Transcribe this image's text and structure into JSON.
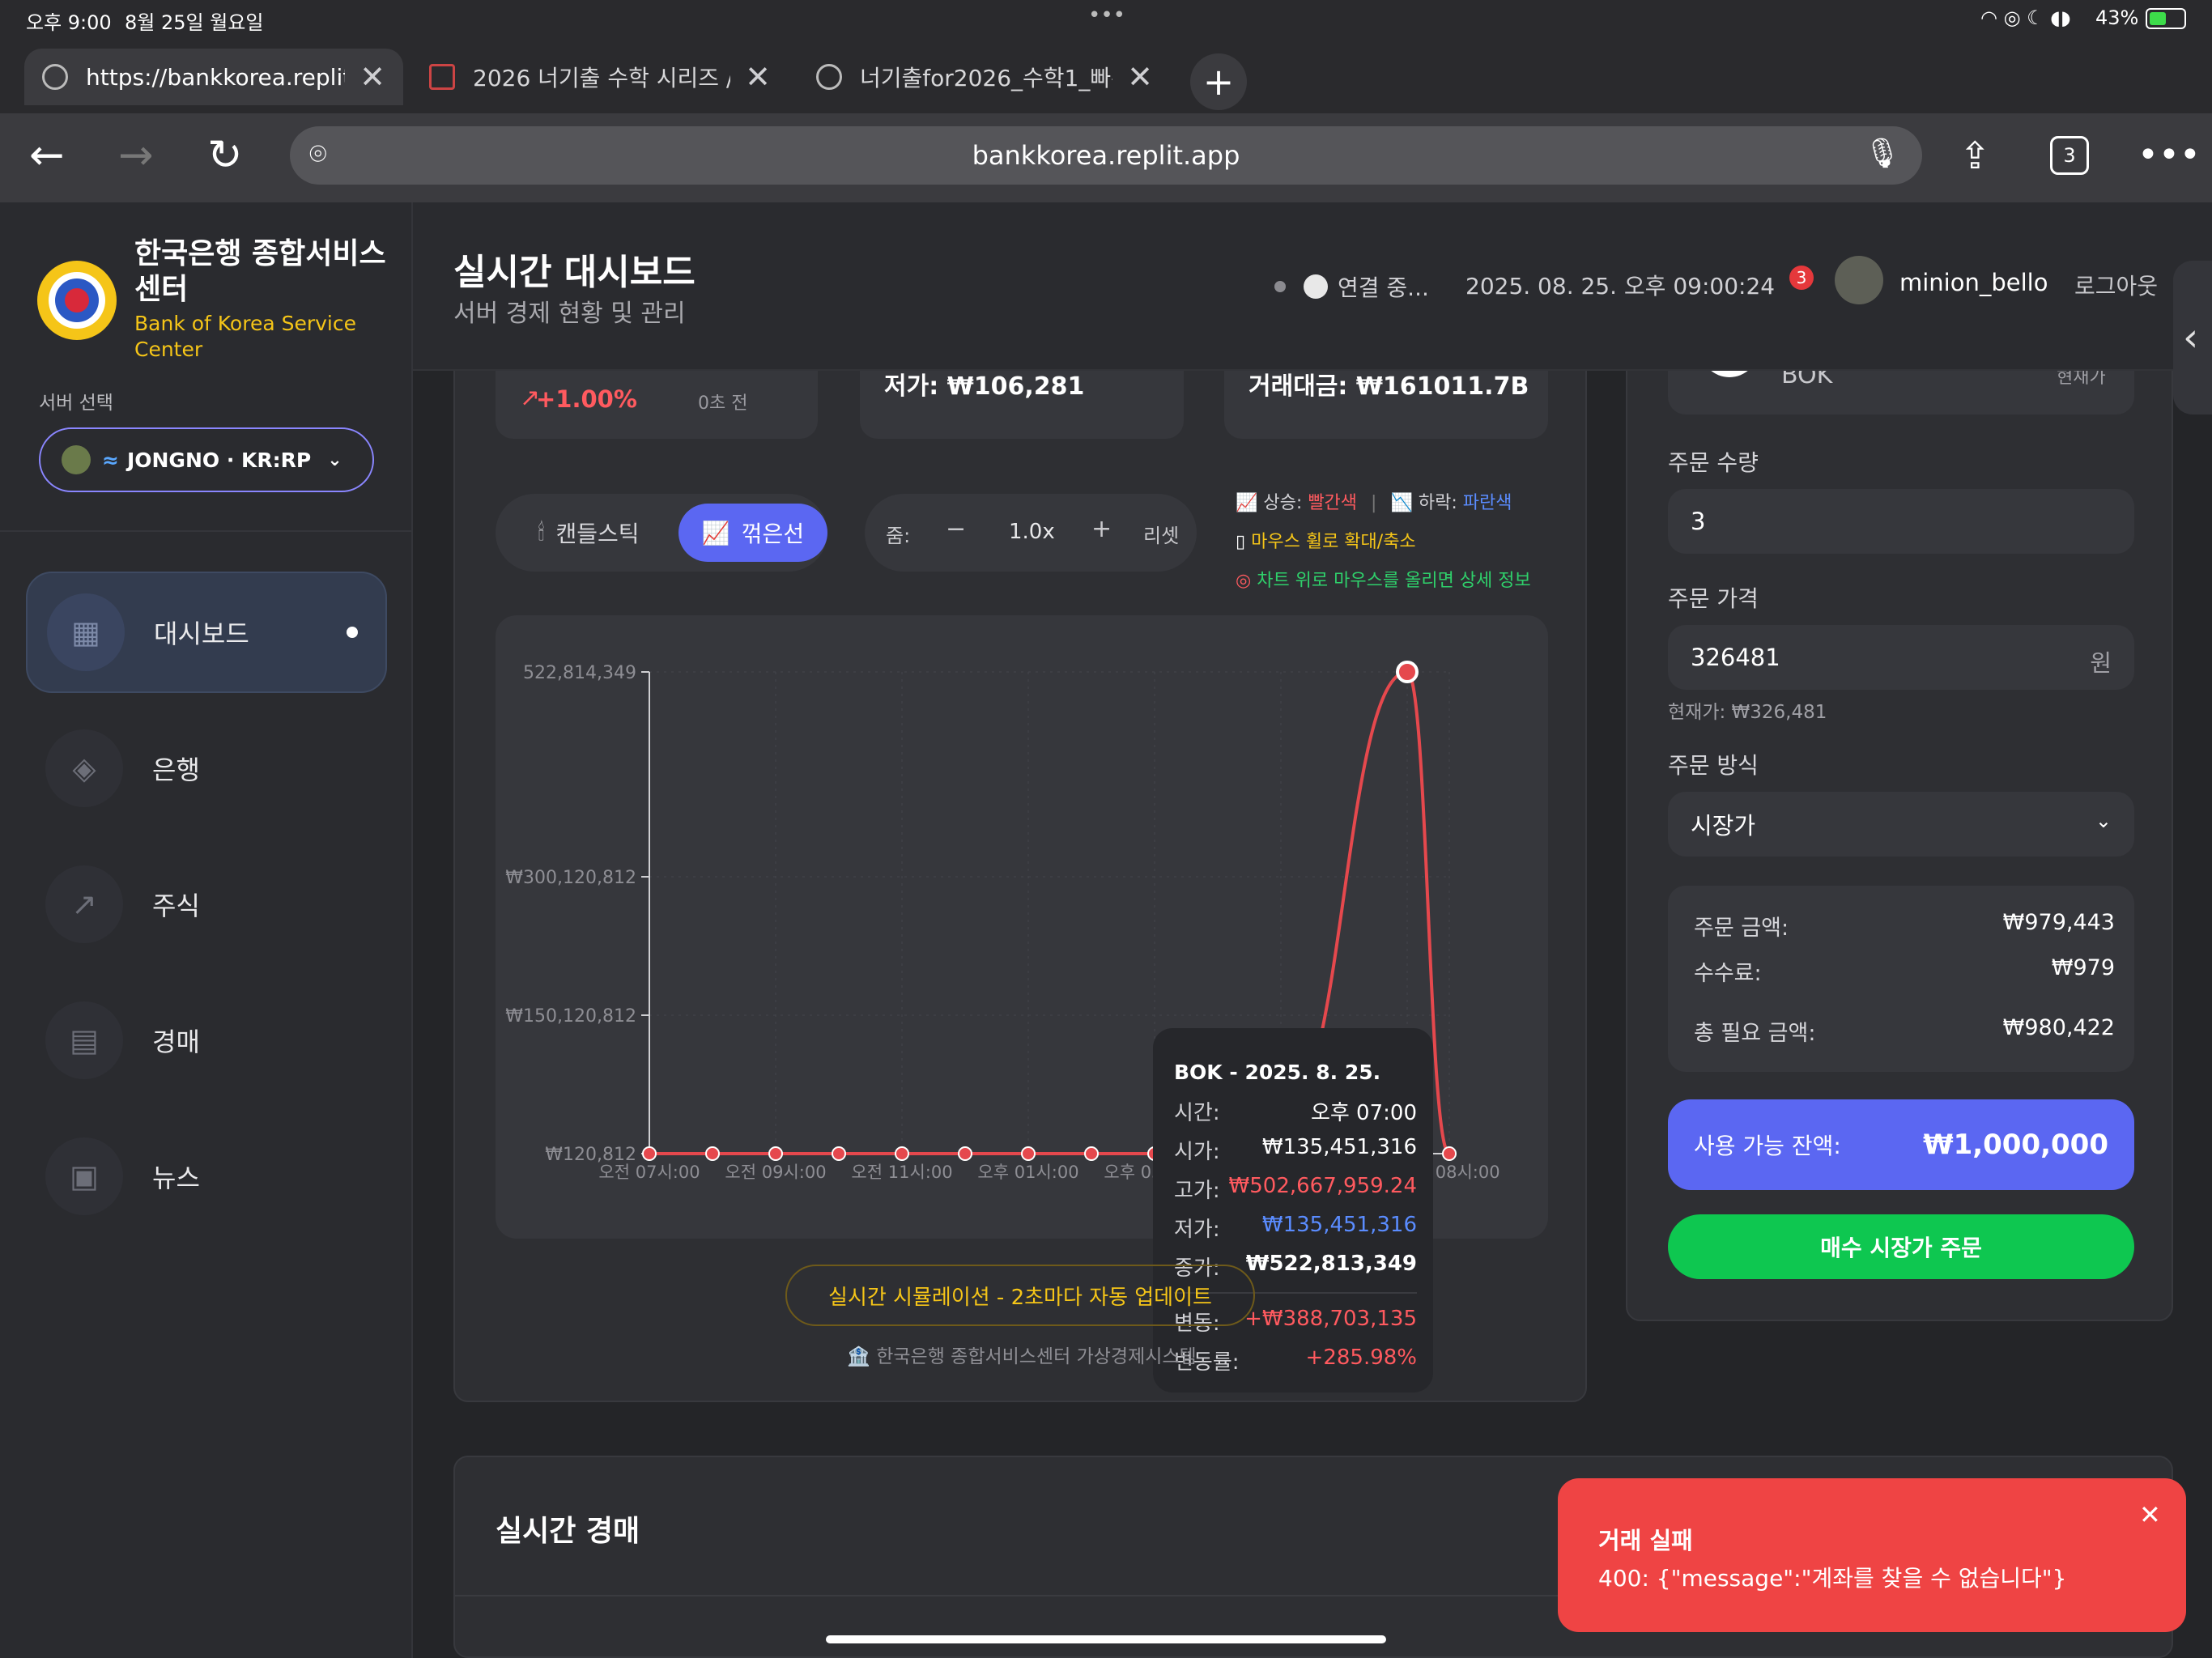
{
  "status_bar": {
    "time": "오후 9:00",
    "date": "8월 25일 월요일",
    "dots": "•••",
    "battery": "43%"
  },
  "browser": {
    "tabs": [
      {
        "title": "https://bankkorea.replit.",
        "active": true
      },
      {
        "title": "2026 너기출 수학 시리즈 / 2",
        "active": false
      },
      {
        "title": "너기출for2026_수학1_빠른",
        "active": false
      }
    ],
    "url": "bankkorea.replit.app",
    "tab_count": "3"
  },
  "sidebar": {
    "brand_ko": "한국은행 종합서비스센터",
    "brand_en": "Bank of Korea Service Center",
    "server_label": "서버 선택",
    "server_name": "JONGNO · KR:RP",
    "nav": [
      {
        "label": "대시보드",
        "icon": "dashboard-icon",
        "active": true
      },
      {
        "label": "은행",
        "icon": "bank-icon",
        "active": false
      },
      {
        "label": "주식",
        "icon": "trend-icon",
        "active": false
      },
      {
        "label": "경매",
        "icon": "auction-icon",
        "active": false
      },
      {
        "label": "뉴스",
        "icon": "news-icon",
        "active": false
      }
    ]
  },
  "header": {
    "title": "실시간 대시보드",
    "subtitle": "서버 경제 현황 및 관리",
    "connection": "연결 중...",
    "datetime": "2025. 08. 25. 오후 09:00:24",
    "notifications": "3",
    "username": "minion_bello",
    "logout": "로그아웃"
  },
  "stats": {
    "change": "+1.00%",
    "updated": "0초 전",
    "low": "저가: ₩106,281",
    "volume": "거래대금: ₩161011.7B"
  },
  "chart_controls": {
    "candle": "캔들스틱",
    "line": "꺾은선",
    "zoom_label": "줌:",
    "zoom_minus": "−",
    "zoom_value": "1.0x",
    "zoom_plus": "+",
    "reset": "리셋",
    "legend_up_label": "상승:",
    "legend_up_value": "빨간색",
    "legend_down_label": "하락:",
    "legend_down_value": "파란색",
    "legend_wheel": "마우스 휠로 확대/축소",
    "legend_hover": "차트 위로 마우스를 올리면 상세 정보"
  },
  "chart_data": {
    "type": "line",
    "series": [
      {
        "values": [
          120812,
          120812,
          120812,
          120812,
          120812,
          120812,
          120812,
          120812,
          120812,
          120812,
          40000000,
          522813349,
          120812
        ]
      }
    ],
    "x_ticks": [
      "오전 07시:00",
      "오전 09시:00",
      "오전 11시:00",
      "오후 01시:00",
      "오후 03시:00",
      "오후 05시:00",
      "오후 08시:00"
    ],
    "y_ticks": [
      "522,814,349",
      "₩300,120,812",
      "₩150,120,812",
      "₩120,812"
    ],
    "y_tick_values": [
      522814349,
      300120812,
      150120812,
      120812
    ],
    "line_color": "#e5484d"
  },
  "tooltip": {
    "title": "BOK - 2025. 8. 25.",
    "time_label": "시간:",
    "time": "오후 07:00",
    "open_label": "시가:",
    "open": "₩135,451,316",
    "high_label": "고가:",
    "high": "₩502,667,959.24",
    "low_label": "저가:",
    "low": "₩135,451,316",
    "close_label": "종가:",
    "close": "₩522,813,349",
    "change_label": "변동:",
    "change": "+₩388,703,135",
    "rate_label": "변동률:",
    "rate": "+285.98%"
  },
  "simulation": "실시간 시뮬레이션 - 2초마다 자동 업데이트",
  "footer_note": "한국은행 종합서비스센터 가상경제시스템",
  "order": {
    "symbol": "BOK",
    "current_label": "현재가",
    "qty_label": "주문 수량",
    "qty": "3",
    "price_label": "주문 가격",
    "price": "326481",
    "price_unit": "원",
    "current_price": "현재가: ₩326,481",
    "method_label": "주문 방식",
    "method": "시장가",
    "amount_label": "주문 금액:",
    "amount": "₩979,443",
    "fee_label": "수수료:",
    "fee": "₩979",
    "total_label": "총 필요 금액:",
    "total": "₩980,422",
    "balance_label": "사용 가능 잔액:",
    "balance": "₩1,000,000",
    "buy_button": "매수 시장가 주문"
  },
  "auction": {
    "title": "실시간 경매"
  },
  "toast": {
    "title": "거래 실패",
    "message": "400: {\"message\":\"계좌를 찾을 수 없습니다\"}"
  }
}
